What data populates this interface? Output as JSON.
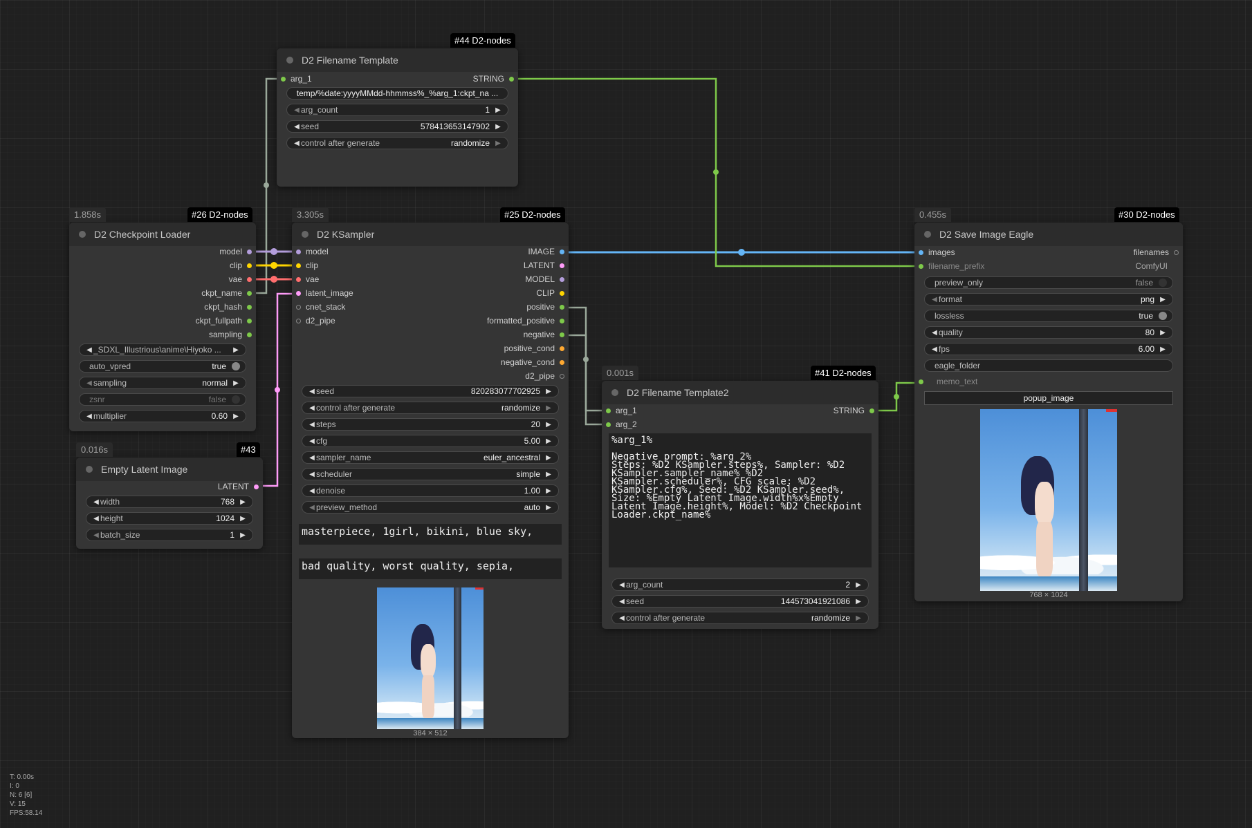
{
  "colors": {
    "model": "#b39ddb",
    "clip": "#ffd500",
    "vae": "#ff6e6e",
    "latent": "#ff9cf9",
    "image": "#64b5f6",
    "string": "#7ec94a",
    "conditioning": "#ffa931",
    "pipe": "#888888",
    "link_gray": "#9aa89a"
  },
  "stats": [
    "T: 0.00s",
    "I: 0",
    "N: 6 [6]",
    "V: 15",
    "FPS:58.14"
  ],
  "nodes": {
    "filename_template": {
      "tag": "#44 D2-nodes",
      "title": "D2 Filename Template",
      "in_arg1": "arg_1",
      "out_string": "STRING",
      "text": "temp/%date:yyyyMMdd-hhmmss%_%arg_1:ckpt_na ...",
      "w_arg_count_lbl": "arg_count",
      "w_arg_count_val": "1",
      "w_seed_lbl": "seed",
      "w_seed_val": "578413653147902",
      "w_control_lbl": "control after generate",
      "w_control_val": "randomize"
    },
    "checkpoint": {
      "timing": "1.858s",
      "tag": "#26 D2-nodes",
      "title": "D2 Checkpoint Loader",
      "outs": [
        "model",
        "clip",
        "vae",
        "ckpt_name",
        "ckpt_hash",
        "ckpt_fullpath",
        "sampling"
      ],
      "w_ckpt": "_SDXL_Illustrious\\anime\\Hiyoko ...",
      "w_auto_vpred_lbl": "auto_vpred",
      "w_auto_vpred_val": "true",
      "w_sampling_lbl": "sampling",
      "w_sampling_val": "normal",
      "w_zsnr_lbl": "zsnr",
      "w_zsnr_val": "false",
      "w_mult_lbl": "multiplier",
      "w_mult_val": "0.60"
    },
    "empty_latent": {
      "timing": "0.016s",
      "tag": "#43",
      "title": "Empty Latent Image",
      "out": "LATENT",
      "w_width_lbl": "width",
      "w_width_val": "768",
      "w_height_lbl": "height",
      "w_height_val": "1024",
      "w_batch_lbl": "batch_size",
      "w_batch_val": "1"
    },
    "ksampler": {
      "timing": "3.305s",
      "tag": "#25 D2-nodes",
      "title": "D2 KSampler",
      "ins": [
        "model",
        "clip",
        "vae",
        "latent_image",
        "cnet_stack",
        "d2_pipe"
      ],
      "outs": [
        "IMAGE",
        "LATENT",
        "MODEL",
        "CLIP",
        "positive",
        "formatted_positive",
        "negative",
        "positive_cond",
        "negative_cond",
        "d2_pipe"
      ],
      "w_seed_lbl": "seed",
      "w_seed_val": "820283077702925",
      "w_control_lbl": "control after generate",
      "w_control_val": "randomize",
      "w_steps_lbl": "steps",
      "w_steps_val": "20",
      "w_cfg_lbl": "cfg",
      "w_cfg_val": "5.00",
      "w_sampler_lbl": "sampler_name",
      "w_sampler_val": "euler_ancestral",
      "w_scheduler_lbl": "scheduler",
      "w_scheduler_val": "simple",
      "w_denoise_lbl": "denoise",
      "w_denoise_val": "1.00",
      "w_preview_lbl": "preview_method",
      "w_preview_val": "auto",
      "positive": "masterpiece, 1girl, bikini, blue sky,",
      "negative": "bad quality, worst quality, sepia,",
      "caption": "384 × 512"
    },
    "filename_template2": {
      "timing": "0.001s",
      "tag": "#41 D2-nodes",
      "title": "D2 Filename Template2",
      "ins": [
        "arg_1",
        "arg_2"
      ],
      "out_string": "STRING",
      "text": "%arg_1%\n\nNegative prompt: %arg_2%\nSteps: %D2 KSampler.steps%, Sampler: %D2 KSampler.sampler_name% %D2 KSampler.scheduler%, CFG scale: %D2 KSampler.cfg%, Seed: %D2 KSampler.seed%, Size: %Empty Latent Image.width%x%Empty Latent Image.height%, Model: %D2 Checkpoint Loader.ckpt_name%",
      "w_arg_count_lbl": "arg_count",
      "w_arg_count_val": "2",
      "w_seed_lbl": "seed",
      "w_seed_val": "144573041921086",
      "w_control_lbl": "control after generate",
      "w_control_val": "randomize"
    },
    "save_eagle": {
      "timing": "0.455s",
      "tag": "#30 D2-nodes",
      "title": "D2 Save Image Eagle",
      "in_images": "images",
      "out_filenames": "filenames",
      "w_prefix_lbl": "filename_prefix",
      "w_prefix_val": "ComfyUI",
      "w_preview_only_lbl": "preview_only",
      "w_preview_only_val": "false",
      "w_format_lbl": "format",
      "w_format_val": "png",
      "w_lossless_lbl": "lossless",
      "w_lossless_val": "true",
      "w_quality_lbl": "quality",
      "w_quality_val": "80",
      "w_fps_lbl": "fps",
      "w_fps_val": "6.00",
      "w_eagle_folder_lbl": "eagle_folder",
      "w_memo_lbl": "memo_text",
      "popup": "popup_image",
      "caption": "768 × 1024"
    }
  }
}
